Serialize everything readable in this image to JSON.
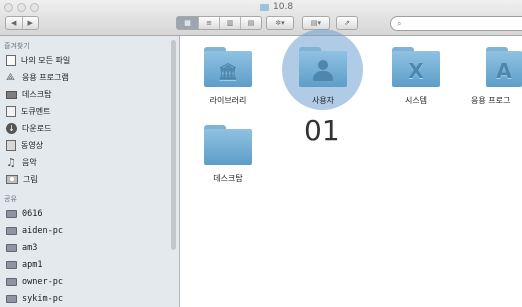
{
  "window": {
    "title": "10.8"
  },
  "toolbar": {
    "back_glyph": "◀",
    "forward_glyph": "▶",
    "view_glyphs": [
      "▦",
      "≡",
      "▥",
      "▤"
    ],
    "action_glyph": "✲▾",
    "arrange_glyph": "▤▾",
    "share_glyph": "⇗",
    "search_glyph": "⌕",
    "search_placeholder": ""
  },
  "sidebar": {
    "favorites_header": "즐겨찾기",
    "favorites": [
      {
        "label": "나의 모든 파일",
        "icon": "all-files-icon"
      },
      {
        "label": "응용 프로그램",
        "icon": "applications-icon"
      },
      {
        "label": "데스크탑",
        "icon": "desktop-icon"
      },
      {
        "label": "도큐멘트",
        "icon": "documents-icon"
      },
      {
        "label": "다운로드",
        "icon": "downloads-icon"
      },
      {
        "label": "동영상",
        "icon": "movies-icon"
      },
      {
        "label": "음악",
        "icon": "music-icon"
      },
      {
        "label": "그림",
        "icon": "pictures-icon"
      }
    ],
    "shared_header": "공유",
    "shared": [
      {
        "label": "0616",
        "icon": "computer-icon"
      },
      {
        "label": "aiden-pc",
        "icon": "computer-icon"
      },
      {
        "label": "am3",
        "icon": "computer-icon"
      },
      {
        "label": "apm1",
        "icon": "computer-icon"
      },
      {
        "label": "owner-pc",
        "icon": "computer-icon"
      },
      {
        "label": "sykim-pc",
        "icon": "computer-icon"
      }
    ]
  },
  "content": {
    "folders": [
      {
        "label": "라이브러리",
        "emblem": "library-icon",
        "glyph": "🏛"
      },
      {
        "label": "사용자",
        "emblem": "user-icon",
        "glyph": ""
      },
      {
        "label": "시스템",
        "emblem": "system-x-icon",
        "glyph": "X"
      },
      {
        "label": "응용 프로그",
        "emblem": "apps-icon",
        "glyph": "A"
      },
      {
        "label": "데스크탑",
        "emblem": "none",
        "glyph": ""
      }
    ],
    "annotation": "01"
  },
  "colors": {
    "highlight": "#6ea0d2",
    "folder": "#7fb2d3",
    "sidebar_bg": "#e4e9ee"
  }
}
